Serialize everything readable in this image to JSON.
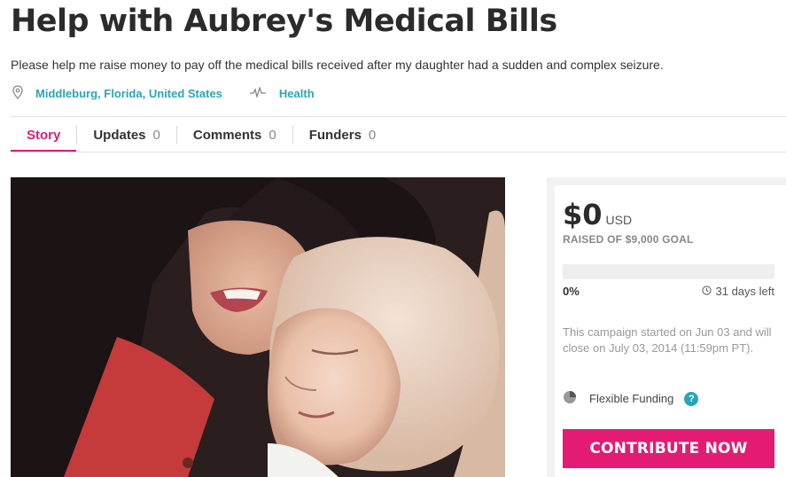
{
  "campaign": {
    "title": "Help with Aubrey's Medical Bills",
    "subtitle": "Please help me raise money to pay off the medical bills received after my daughter had a sudden and complex seizure.",
    "location": "Middleburg, Florida, United States",
    "category": "Health"
  },
  "tabs": [
    {
      "label": "Story",
      "count": "",
      "active": true
    },
    {
      "label": "Updates",
      "count": "0",
      "active": false
    },
    {
      "label": "Comments",
      "count": "0",
      "active": false
    },
    {
      "label": "Funders",
      "count": "0",
      "active": false
    }
  ],
  "funding": {
    "amount": "$0",
    "currency": "USD",
    "goal_text": "RAISED OF $9,000 GOAL",
    "progress_fraction": 0,
    "percent_label": "0%",
    "days_left": "31 days left",
    "schedule_text": "This campaign started on Jun 03 and will close on July 03, 2014 (11:59pm PT).",
    "funding_type": "Flexible Funding",
    "help_glyph": "?",
    "contribute_label": "CONTRIBUTE NOW"
  },
  "icons": {
    "location": "map-pin-icon",
    "category": "pulse-icon",
    "clock": "clock-icon",
    "funding": "half-pie-icon"
  },
  "colors": {
    "accent": "#e31b72",
    "link": "#2aa5b8"
  }
}
